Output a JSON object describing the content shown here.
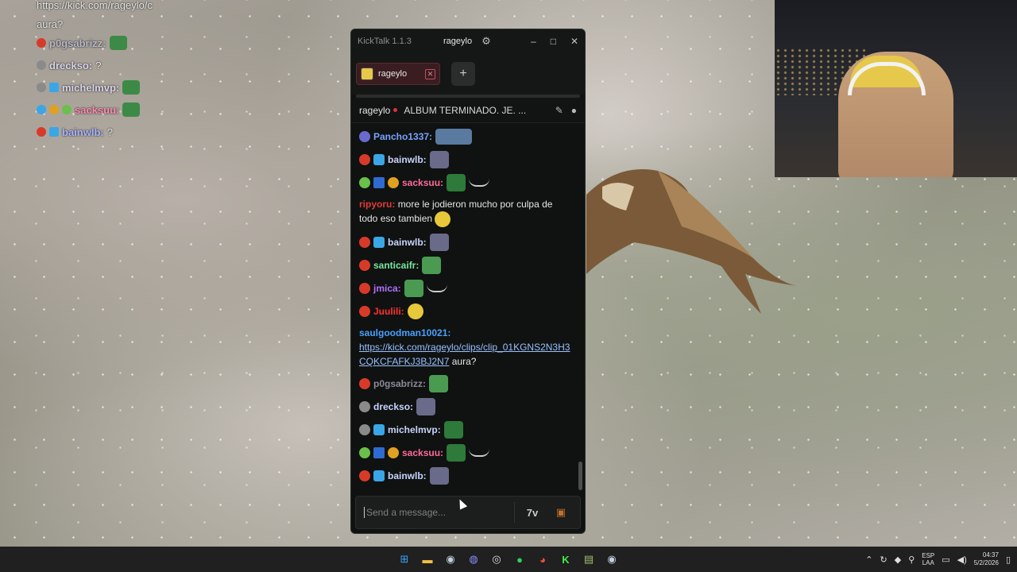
{
  "overlay_chat": {
    "lines": [
      {
        "user": "",
        "text": "https://kick.com/rageylo/c"
      },
      {
        "user": "",
        "text": "aura?"
      },
      {
        "user": "p0gsabrizz:",
        "text": ""
      },
      {
        "user": "drecksо:",
        "text": "?"
      },
      {
        "user": "michelmvp:",
        "text": ""
      },
      {
        "user": "sacksuu:",
        "text": ""
      },
      {
        "user": "bainwlb:",
        "text": "?"
      }
    ]
  },
  "window": {
    "app_title": "KickTalk 1.1.3",
    "user": "rageylo",
    "controls": {
      "minimize": "–",
      "maximize": "□",
      "close": "✕"
    }
  },
  "tabs": [
    {
      "label": "rageylo",
      "close": "✕"
    }
  ],
  "add_tab": "+",
  "stream_header": {
    "channel": "rageylo",
    "title": "ALBUM TERMINADO. JE. ..."
  },
  "messages": [
    {
      "user": "Pancho1337:",
      "color": "#7aa0ff",
      "text": ""
    },
    {
      "user": "bainwlb:",
      "color": "#c8d4ff",
      "text": ""
    },
    {
      "user": "sacksuu:",
      "color": "#ff6a9a",
      "text": ""
    },
    {
      "user": "ripyoru:",
      "color": "#e23a3a",
      "text": "more le jodieron mucho por culpa de todo eso tambien"
    },
    {
      "user": "bainwlb:",
      "color": "#c8d4ff",
      "text": ""
    },
    {
      "user": "santicaifr:",
      "color": "#7ae6a0",
      "text": ""
    },
    {
      "user": "jmica:",
      "color": "#b070ff",
      "text": ""
    },
    {
      "user": "Juulili:",
      "color": "#ff3030",
      "text": ""
    },
    {
      "user": "saulgoodman10021:",
      "color": "#4aa0ff",
      "link": "https://kick.com/rageylo/clips/clip_01KGNS2N3H3CQKCFAFKJ3BJ2N7",
      "text": "aura?"
    },
    {
      "user": "p0gsabrizz:",
      "color": "#8a8a9a",
      "text": ""
    },
    {
      "user": "drecksо:",
      "color": "#c8d4ff",
      "text": ""
    },
    {
      "user": "michelmvp:",
      "color": "#c8d4ff",
      "text": ""
    },
    {
      "user": "sacksuu:",
      "color": "#ff6a9a",
      "text": ""
    },
    {
      "user": "bainwlb:",
      "color": "#c8d4ff",
      "text": ""
    }
  ],
  "input": {
    "placeholder": "Send a message..."
  },
  "tray": {
    "lang_top": "ESP",
    "lang_bottom": "LAA",
    "time": "04:37",
    "date": "5/2/2026"
  }
}
